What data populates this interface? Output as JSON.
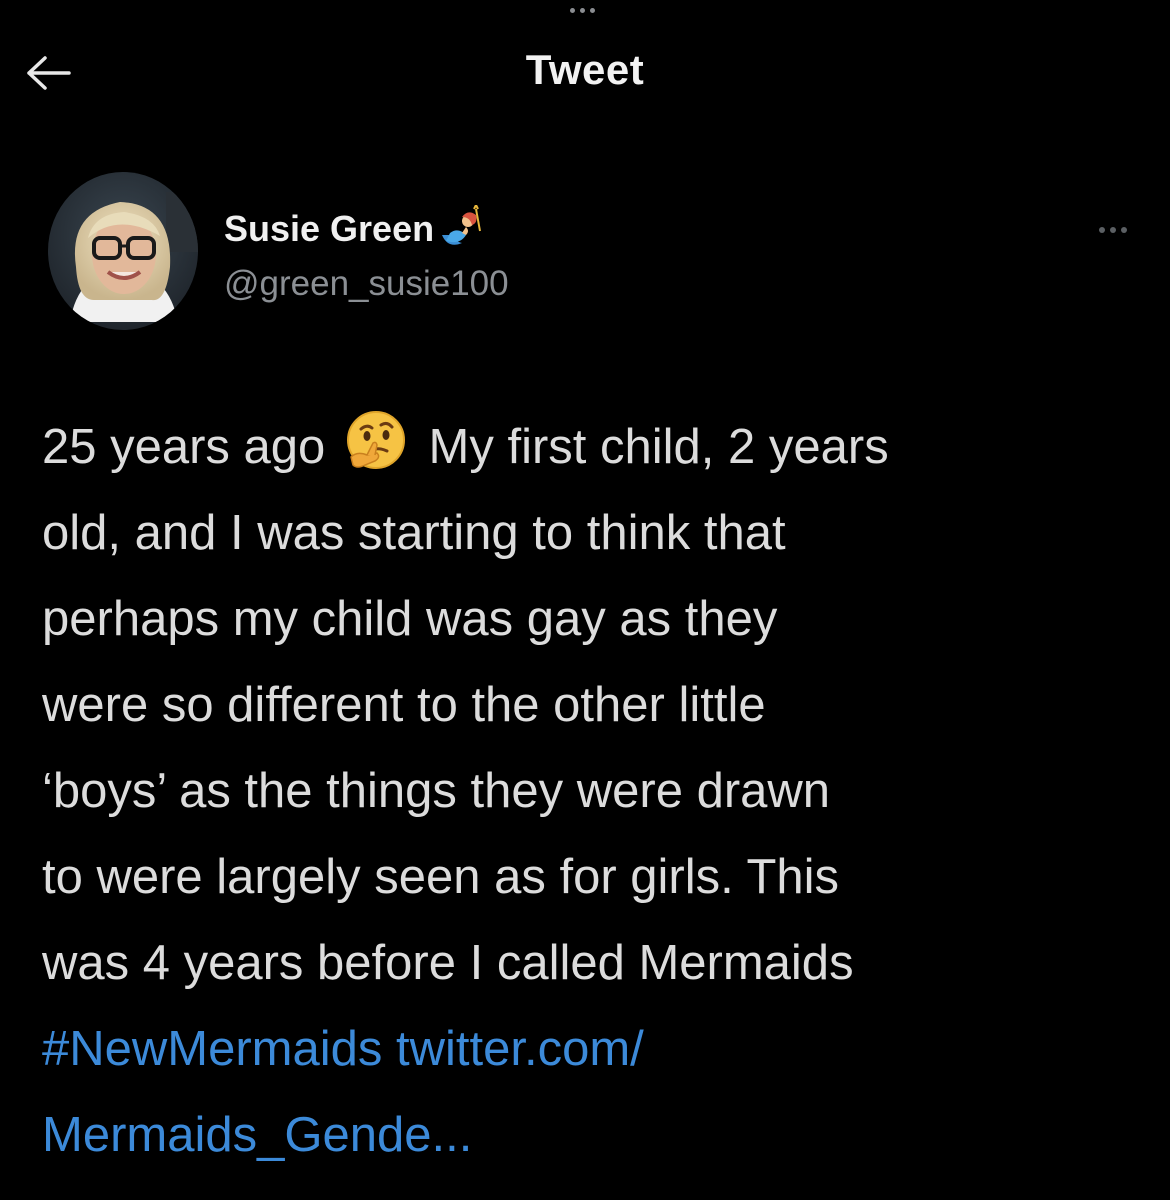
{
  "header": {
    "title": "Tweet",
    "back_icon": "back-arrow-icon"
  },
  "author": {
    "display_name": "Susie Green",
    "name_emoji": "mermaid-emoji",
    "handle": "@green_susie100",
    "avatar": "avatar-photo"
  },
  "tweet": {
    "lines": [
      {
        "before": "25 years ago",
        "emoji": "thinking-face-emoji",
        "after": "My first child, 2 years"
      },
      "old, and I was starting to think that",
      "perhaps my child was gay as they",
      "were so different to the other little",
      "‘boys’ as the things they were drawn",
      "to were largely seen as for girls. This",
      "was 4 years before I called Mermaids"
    ],
    "hashtag": "#NewMermaids",
    "link_part1": "twitter.com/",
    "link_part2": "Mermaids_Gende..."
  },
  "colors": {
    "background": "#000000",
    "text": "#dcdcdc",
    "secondary": "#8b8f94",
    "link": "#3c8ad9"
  }
}
